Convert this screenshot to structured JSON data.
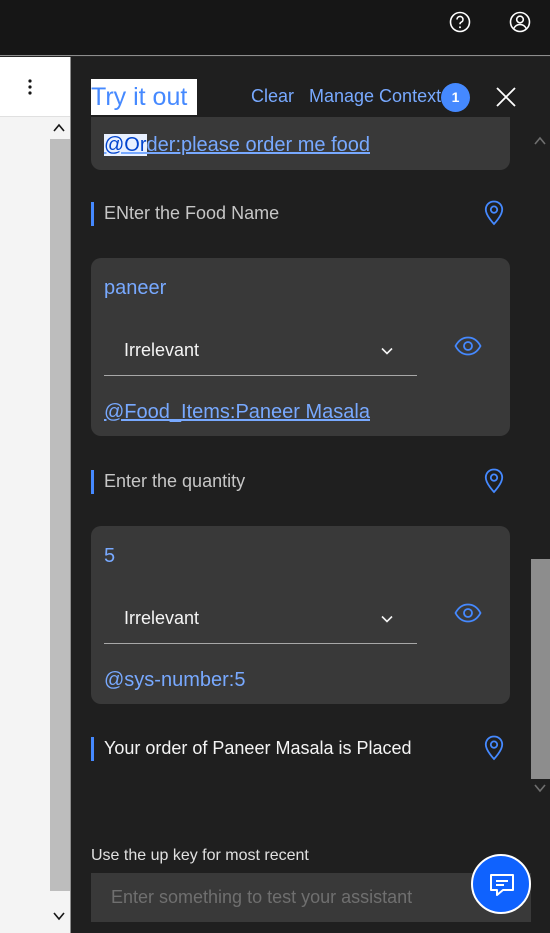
{
  "topbar": {
    "help_icon": "help-icon",
    "user_icon": "user-avatar-icon"
  },
  "left_pane": {
    "overflow_icon": "overflow-menu-icon"
  },
  "panel": {
    "title": "Try it out",
    "clear_label": "Clear",
    "manage_context_label": "Manage Context",
    "context_count": "1",
    "close_icon": "close-icon"
  },
  "conversation": {
    "first_entity_highlight": "@Or",
    "first_entity_rest": "der:please order me food",
    "messages": [
      {
        "type": "bot",
        "text": "ENter the Food Name"
      },
      {
        "type": "user",
        "text": "paneer",
        "intent": "Irrelevant",
        "entity": "@Food_Items:Paneer Masala"
      },
      {
        "type": "bot",
        "text": "Enter the quantity"
      },
      {
        "type": "user",
        "text": "5",
        "intent": "Irrelevant",
        "entity": "@sys-number:5"
      },
      {
        "type": "bot",
        "text": "Your order of Paneer Masala is Placed"
      }
    ]
  },
  "footer": {
    "hint": "Use the up key for most recent",
    "input_placeholder": "Enter something to test your assistant",
    "chat_icon": "chat-icon"
  },
  "colors": {
    "accent": "#4589ff",
    "link": "#78a9ff",
    "panel_bg": "#1f1f1f",
    "card_bg": "#393939"
  }
}
